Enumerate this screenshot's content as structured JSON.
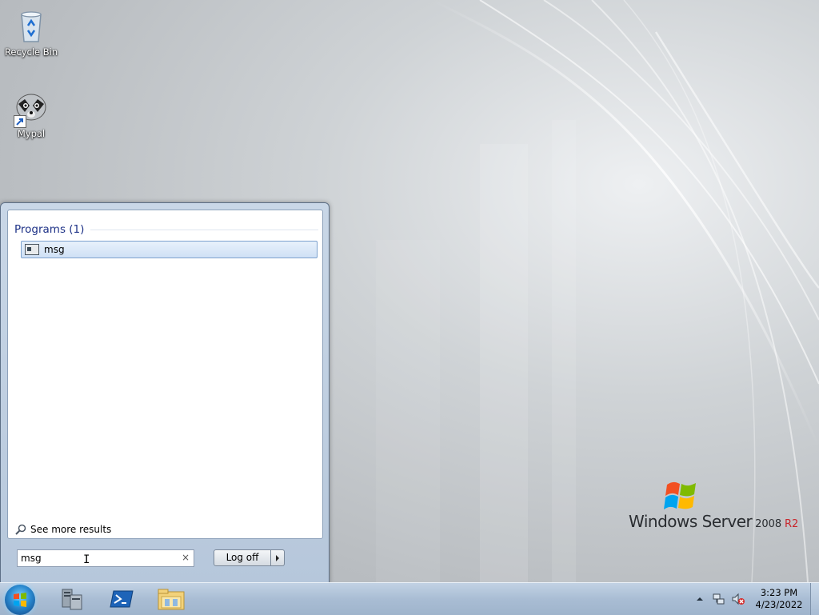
{
  "desktop": {
    "icons": [
      {
        "label": "Recycle Bin",
        "icon": "recycle-bin-icon"
      },
      {
        "label": "Mypal",
        "icon": "raccoon-icon"
      }
    ],
    "brand": {
      "name": "Windows Server",
      "version": "2008",
      "edition": "R2"
    }
  },
  "start_menu": {
    "group_header": "Programs (1)",
    "results": [
      {
        "label": "msg",
        "icon": "console-app-icon"
      }
    ],
    "see_more": "See more results",
    "search": {
      "value": "msg",
      "clear_icon": "×"
    },
    "logoff_label": "Log off"
  },
  "taskbar": {
    "pinned": [
      {
        "icon": "server-manager-icon"
      },
      {
        "icon": "powershell-icon"
      },
      {
        "icon": "file-explorer-icon"
      }
    ],
    "clock": {
      "time": "3:23 PM",
      "date": "4/23/2022"
    }
  },
  "colors": {
    "accent": "#1e3287",
    "selection": "#cfe0f5",
    "r2": "#c8262c"
  }
}
